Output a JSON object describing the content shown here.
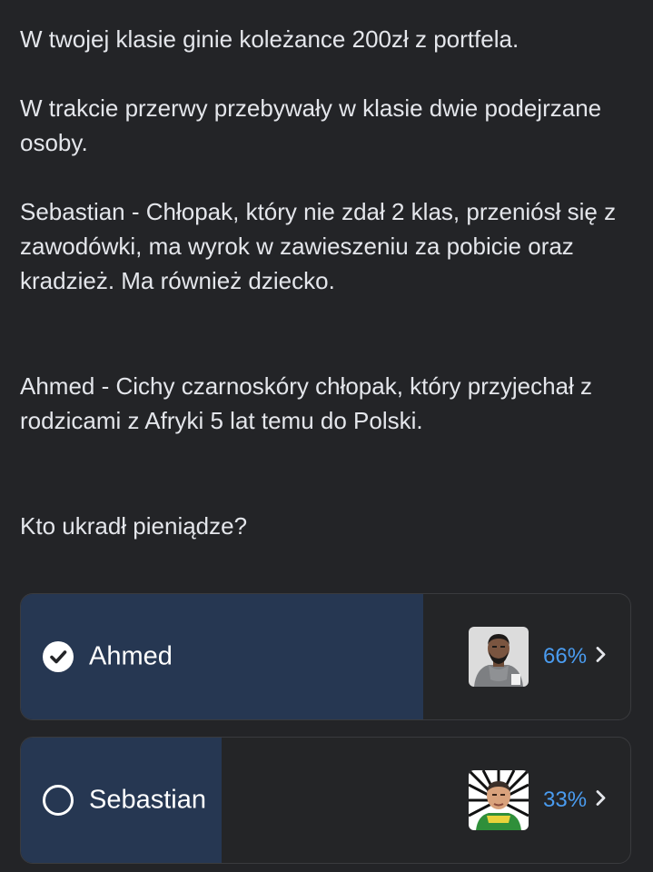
{
  "post": {
    "paragraphs": [
      "W twojej klasie ginie koleżance 200zł z portfela.",
      "W trakcie przerwy przebywały w klasie dwie podejrzane osoby.",
      "Sebastian - Chłopak, który nie zdał 2 klas, przeniósł się z zawodówki, ma wyrok w zawieszeniu za pobicie oraz kradzież. Ma również dziecko.",
      "Ahmed - Cichy czarnoskóry chłopak, który przyjechał z rodzicami z Afryki 5 lat temu do Polski.",
      "Kto ukradł pieniądze?"
    ]
  },
  "poll": {
    "options": [
      {
        "label": "Ahmed",
        "percent_text": "66%",
        "fraction": 0.66,
        "selected": true,
        "avatar": "man-with-beard-avatar"
      },
      {
        "label": "Sebastian",
        "percent_text": "33%",
        "fraction": 0.33,
        "selected": false,
        "avatar": "young-man-avatar"
      }
    ]
  },
  "colors": {
    "background": "#232427",
    "bar_fill": "#263752",
    "percent": "#4a9cf0",
    "text": "#e4e6eb"
  }
}
